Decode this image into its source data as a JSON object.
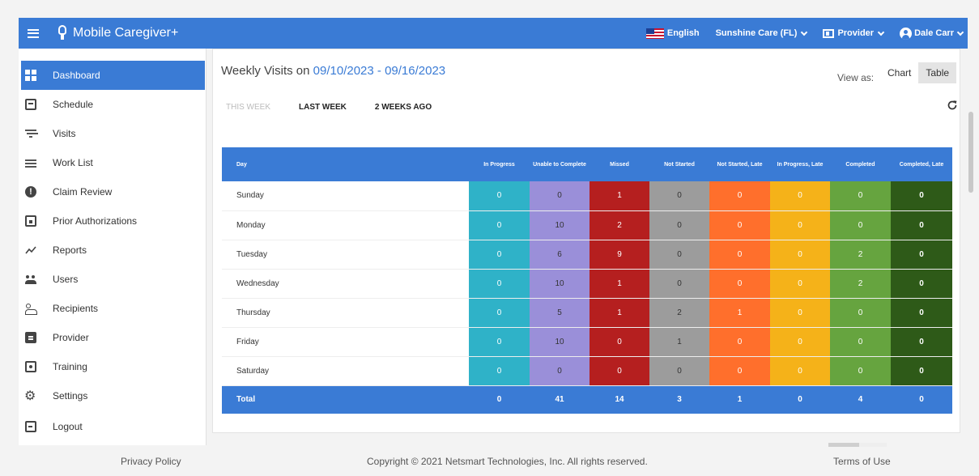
{
  "header": {
    "app_title": "Mobile Caregiver+",
    "language": "English",
    "agency": "Sunshine Care (FL)",
    "role": "Provider",
    "user": "Dale Carr"
  },
  "sidebar": {
    "items": [
      {
        "label": "Dashboard",
        "icon": "dashboard-icon",
        "active": true
      },
      {
        "label": "Schedule",
        "icon": "calendar-icon"
      },
      {
        "label": "Visits",
        "icon": "filter-icon"
      },
      {
        "label": "Work List",
        "icon": "list-icon"
      },
      {
        "label": "Claim Review",
        "icon": "alert-icon"
      },
      {
        "label": "Prior Authorizations",
        "icon": "event-icon"
      },
      {
        "label": "Reports",
        "icon": "trend-icon"
      },
      {
        "label": "Users",
        "icon": "people-icon"
      },
      {
        "label": "Recipients",
        "icon": "people-outline-icon"
      },
      {
        "label": "Provider",
        "icon": "clipboard-icon"
      },
      {
        "label": "Training",
        "icon": "training-icon"
      },
      {
        "label": "Settings",
        "icon": "gear-icon"
      },
      {
        "label": "Logout",
        "icon": "logout-icon"
      }
    ]
  },
  "main": {
    "heading_prefix": "Weekly Visits on ",
    "heading_dates": "09/10/2023 - 09/16/2023",
    "view_as_label": "View as:",
    "view_options": [
      "Chart",
      "Table"
    ],
    "view_selected": "Table",
    "tabs": [
      "THIS WEEK",
      "LAST WEEK",
      "2 WEEKS AGO"
    ],
    "table": {
      "columns": [
        "Day",
        "In Progress",
        "Unable to Complete",
        "Missed",
        "Not Started",
        "Not Started, Late",
        "In Progress, Late",
        "Completed",
        "Completed, Late"
      ],
      "rows": [
        {
          "day": "Sunday",
          "values": [
            "0",
            "0",
            "1",
            "0",
            "0",
            "0",
            "0",
            "0"
          ]
        },
        {
          "day": "Monday",
          "values": [
            "0",
            "10",
            "2",
            "0",
            "0",
            "0",
            "0",
            "0"
          ]
        },
        {
          "day": "Tuesday",
          "values": [
            "0",
            "6",
            "9",
            "0",
            "0",
            "0",
            "2",
            "0"
          ]
        },
        {
          "day": "Wednesday",
          "values": [
            "0",
            "10",
            "1",
            "0",
            "0",
            "0",
            "2",
            "0"
          ]
        },
        {
          "day": "Thursday",
          "values": [
            "0",
            "5",
            "1",
            "2",
            "1",
            "0",
            "0",
            "0"
          ]
        },
        {
          "day": "Friday",
          "values": [
            "0",
            "10",
            "0",
            "1",
            "0",
            "0",
            "0",
            "0"
          ]
        },
        {
          "day": "Saturday",
          "values": [
            "0",
            "0",
            "0",
            "0",
            "0",
            "0",
            "0",
            "0"
          ]
        }
      ],
      "total": {
        "day": "Total",
        "values": [
          "0",
          "41",
          "14",
          "3",
          "1",
          "0",
          "4",
          "0"
        ]
      }
    }
  },
  "footer": {
    "privacy": "Privacy Policy",
    "copyright": "Copyright © 2021 Netsmart Technologies, Inc. All rights reserved.",
    "terms": "Terms of Use"
  },
  "colors": {
    "brand_blue": "#3a7bd5",
    "in_progress": "#2fb2c8",
    "unable_to_complete": "#9a8fd9",
    "missed": "#b51f1f",
    "not_started": "#9c9c9c",
    "not_started_late": "#ff6f2c",
    "in_progress_late": "#f5b219",
    "completed": "#66a43f",
    "completed_late": "#2e5a18"
  }
}
